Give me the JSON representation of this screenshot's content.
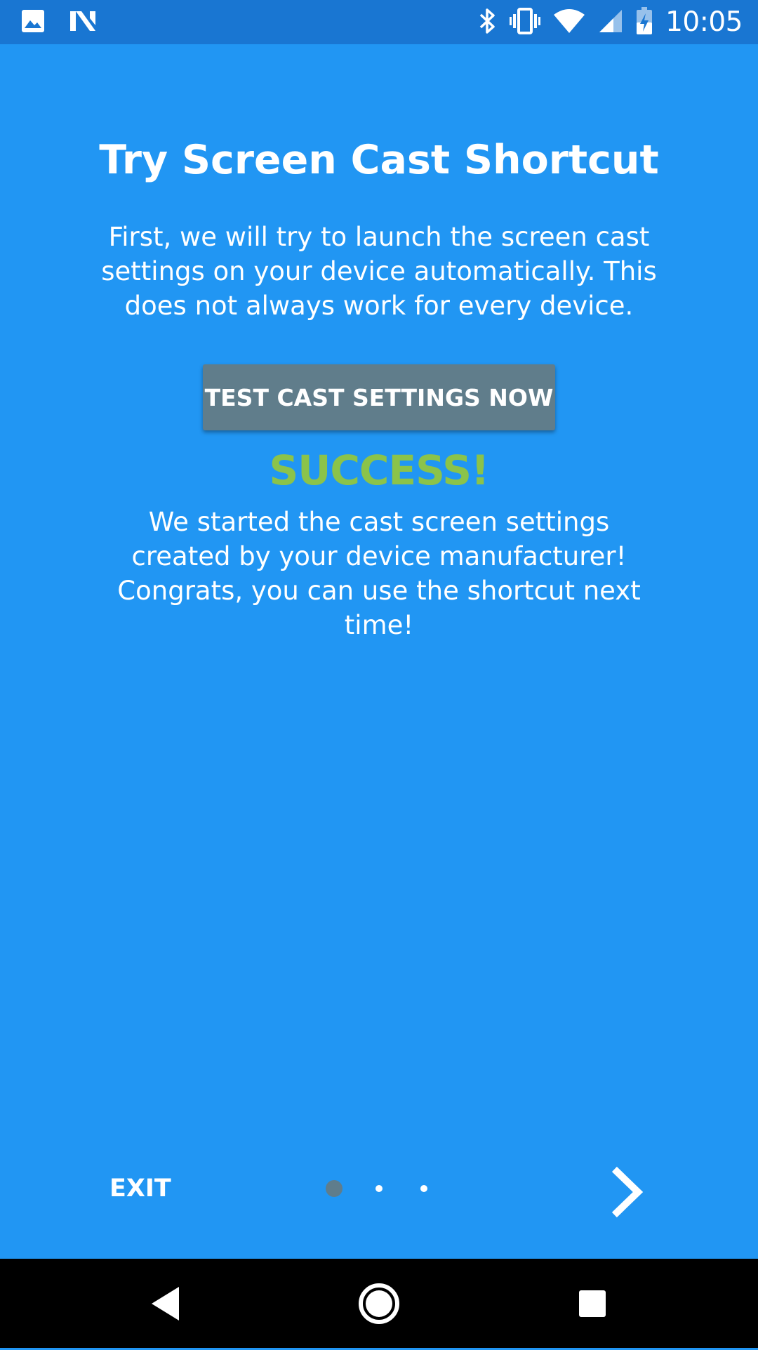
{
  "status_bar": {
    "time": "10:05",
    "icons_left": [
      "gallery-icon",
      "n-notification-icon"
    ],
    "icons_right": [
      "bluetooth-icon",
      "vibrate-icon",
      "wifi-icon",
      "cell-signal-icon",
      "battery-charging-icon"
    ]
  },
  "onboarding": {
    "title": "Try Screen Cast Shortcut",
    "description": "First, we will try to launch the screen cast settings on your device automatically. This does not always work for every device.",
    "test_button_label": "TEST CAST SETTINGS NOW",
    "result_title": "SUCCESS!",
    "result_message": "We started the cast screen settings created by your device manufacturer! Congrats, you can use the shortcut next time!"
  },
  "footer": {
    "exit_label": "EXIT",
    "page_count": 3,
    "current_page": 1,
    "next_icon": "chevron-right-icon"
  },
  "nav_bar": {
    "icons": [
      "back-icon",
      "home-icon",
      "recents-icon"
    ]
  },
  "colors": {
    "background": "#2196f3",
    "status_bar": "#1976d2",
    "button": "#607d8b",
    "success": "#8bc34a",
    "active_dot": "#5f7d8c"
  }
}
